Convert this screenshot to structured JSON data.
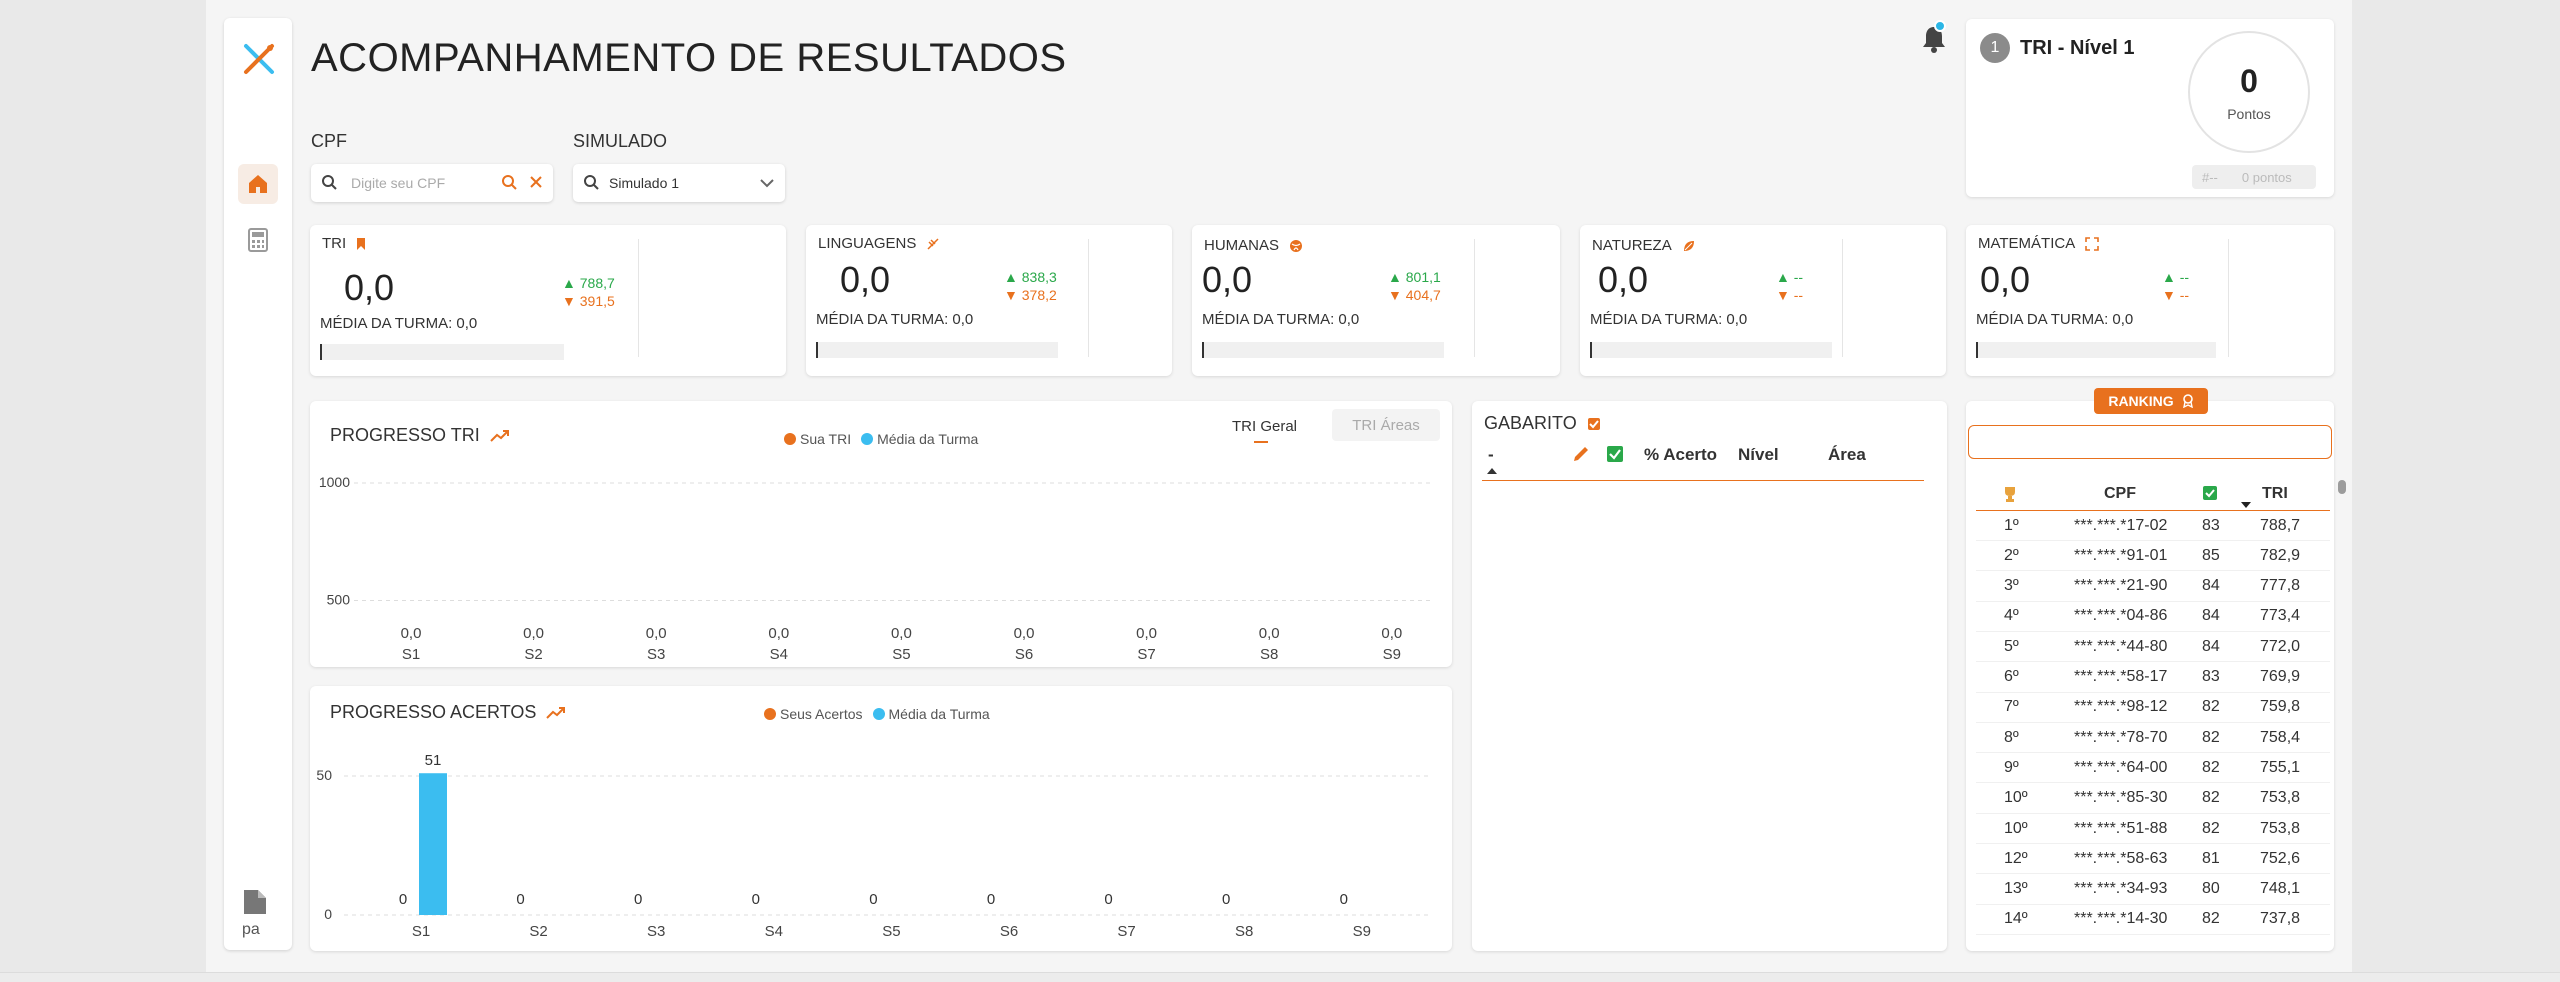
{
  "page": {
    "title": "ACOMPANHAMENTO DE RESULTADOS"
  },
  "sidebar": {
    "items": [
      "home-icon",
      "calculator-icon"
    ],
    "footer_logo": "pa"
  },
  "filters": {
    "cpf": {
      "label": "CPF",
      "placeholder": "Digite seu CPF"
    },
    "simulado": {
      "label": "SIMULADO",
      "value": "Simulado 1"
    }
  },
  "level": {
    "number": "1",
    "title": "TRI - Nível 1",
    "points": "0",
    "points_label": "Pontos",
    "rank": "#--",
    "rank_points": "0 pontos"
  },
  "scores": [
    {
      "title": "TRI",
      "icon": "bookmark-icon",
      "value": "0,0",
      "up": "788,7",
      "down": "391,5",
      "mean": "MÉDIA DA TURMA: 0,0"
    },
    {
      "title": "LINGUAGENS",
      "icon": "sparkle-icon",
      "value": "0,0",
      "up": "838,3",
      "down": "378,2",
      "mean": "MÉDIA DA TURMA: 0,0"
    },
    {
      "title": "HUMANAS",
      "icon": "globe-icon",
      "value": "0,0",
      "up": "801,1",
      "down": "404,7",
      "mean": "MÉDIA DA TURMA: 0,0"
    },
    {
      "title": "NATUREZA",
      "icon": "leaf-icon",
      "value": "0,0",
      "up": "--",
      "down": "--",
      "mean": "MÉDIA DA TURMA: 0,0"
    },
    {
      "title": "MATEMÁTICA",
      "icon": "expand-icon",
      "value": "0,0",
      "up": "--",
      "down": "--",
      "mean": "MÉDIA DA TURMA: 0,0"
    }
  ],
  "colors": {
    "accent": "#e8711e",
    "blue": "#3bbdf0",
    "green": "#2aa84a"
  },
  "tri_chart": {
    "title": "PROGRESSO TRI",
    "legend": [
      "Sua TRI",
      "Média da Turma"
    ],
    "tabs": {
      "active": "TRI Geral",
      "inactive": "TRI Áreas"
    }
  },
  "acertos_chart": {
    "title": "PROGRESSO ACERTOS",
    "legend": [
      "Seus Acertos",
      "Média da Turma"
    ]
  },
  "chart_data": [
    {
      "type": "line",
      "title": "PROGRESSO TRI",
      "categories": [
        "S1",
        "S2",
        "S3",
        "S4",
        "S5",
        "S6",
        "S7",
        "S8",
        "S9"
      ],
      "series": [
        {
          "name": "Sua TRI",
          "values": [
            0,
            0,
            0,
            0,
            0,
            0,
            0,
            0,
            0
          ]
        },
        {
          "name": "Média da Turma",
          "values": [
            0,
            0,
            0,
            0,
            0,
            0,
            0,
            0,
            0
          ]
        }
      ],
      "value_labels": [
        "0,0",
        "0,0",
        "0,0",
        "0,0",
        "0,0",
        "0,0",
        "0,0",
        "0,0",
        "0,0"
      ],
      "yticks": [
        "1000",
        "500"
      ],
      "ylim": [
        0,
        1000
      ],
      "grid": true
    },
    {
      "type": "bar",
      "title": "PROGRESSO ACERTOS",
      "categories": [
        "S1",
        "S2",
        "S3",
        "S4",
        "S5",
        "S6",
        "S7",
        "S8",
        "S9"
      ],
      "series": [
        {
          "name": "Seus Acertos",
          "values": [
            0,
            0,
            0,
            0,
            0,
            0,
            0,
            0,
            0
          ]
        },
        {
          "name": "Média da Turma",
          "values": [
            51,
            0,
            0,
            0,
            0,
            0,
            0,
            0,
            0
          ]
        }
      ],
      "yticks": [
        "50",
        "0"
      ],
      "ylim": [
        0,
        60
      ],
      "grid": true
    }
  ],
  "gabarito": {
    "title": "GABARITO",
    "columns": {
      "sort": "-",
      "acerto": "% Acerto",
      "nivel": "Nível",
      "area": "Área"
    }
  },
  "ranking": {
    "badge": "RANKING",
    "columns": {
      "cpf": "CPF",
      "tri": "TRI"
    },
    "rows": [
      {
        "pos": "1º",
        "cpf": "***.***.*17-02",
        "acertos": "83",
        "tri": "788,7"
      },
      {
        "pos": "2º",
        "cpf": "***.***.*91-01",
        "acertos": "85",
        "tri": "782,9"
      },
      {
        "pos": "3º",
        "cpf": "***.***.*21-90",
        "acertos": "84",
        "tri": "777,8"
      },
      {
        "pos": "4º",
        "cpf": "***.***.*04-86",
        "acertos": "84",
        "tri": "773,4"
      },
      {
        "pos": "5º",
        "cpf": "***.***.*44-80",
        "acertos": "84",
        "tri": "772,0"
      },
      {
        "pos": "6º",
        "cpf": "***.***.*58-17",
        "acertos": "83",
        "tri": "769,9"
      },
      {
        "pos": "7º",
        "cpf": "***.***.*98-12",
        "acertos": "82",
        "tri": "759,8"
      },
      {
        "pos": "8º",
        "cpf": "***.***.*78-70",
        "acertos": "82",
        "tri": "758,4"
      },
      {
        "pos": "9º",
        "cpf": "***.***.*64-00",
        "acertos": "82",
        "tri": "755,1"
      },
      {
        "pos": "10º",
        "cpf": "***.***.*85-30",
        "acertos": "82",
        "tri": "753,8"
      },
      {
        "pos": "10º",
        "cpf": "***.***.*51-88",
        "acertos": "82",
        "tri": "753,8"
      },
      {
        "pos": "12º",
        "cpf": "***.***.*58-63",
        "acertos": "81",
        "tri": "752,6"
      },
      {
        "pos": "13º",
        "cpf": "***.***.*34-93",
        "acertos": "80",
        "tri": "748,1"
      },
      {
        "pos": "14º",
        "cpf": "***.***.*14-30",
        "acertos": "82",
        "tri": "737,8"
      }
    ]
  }
}
